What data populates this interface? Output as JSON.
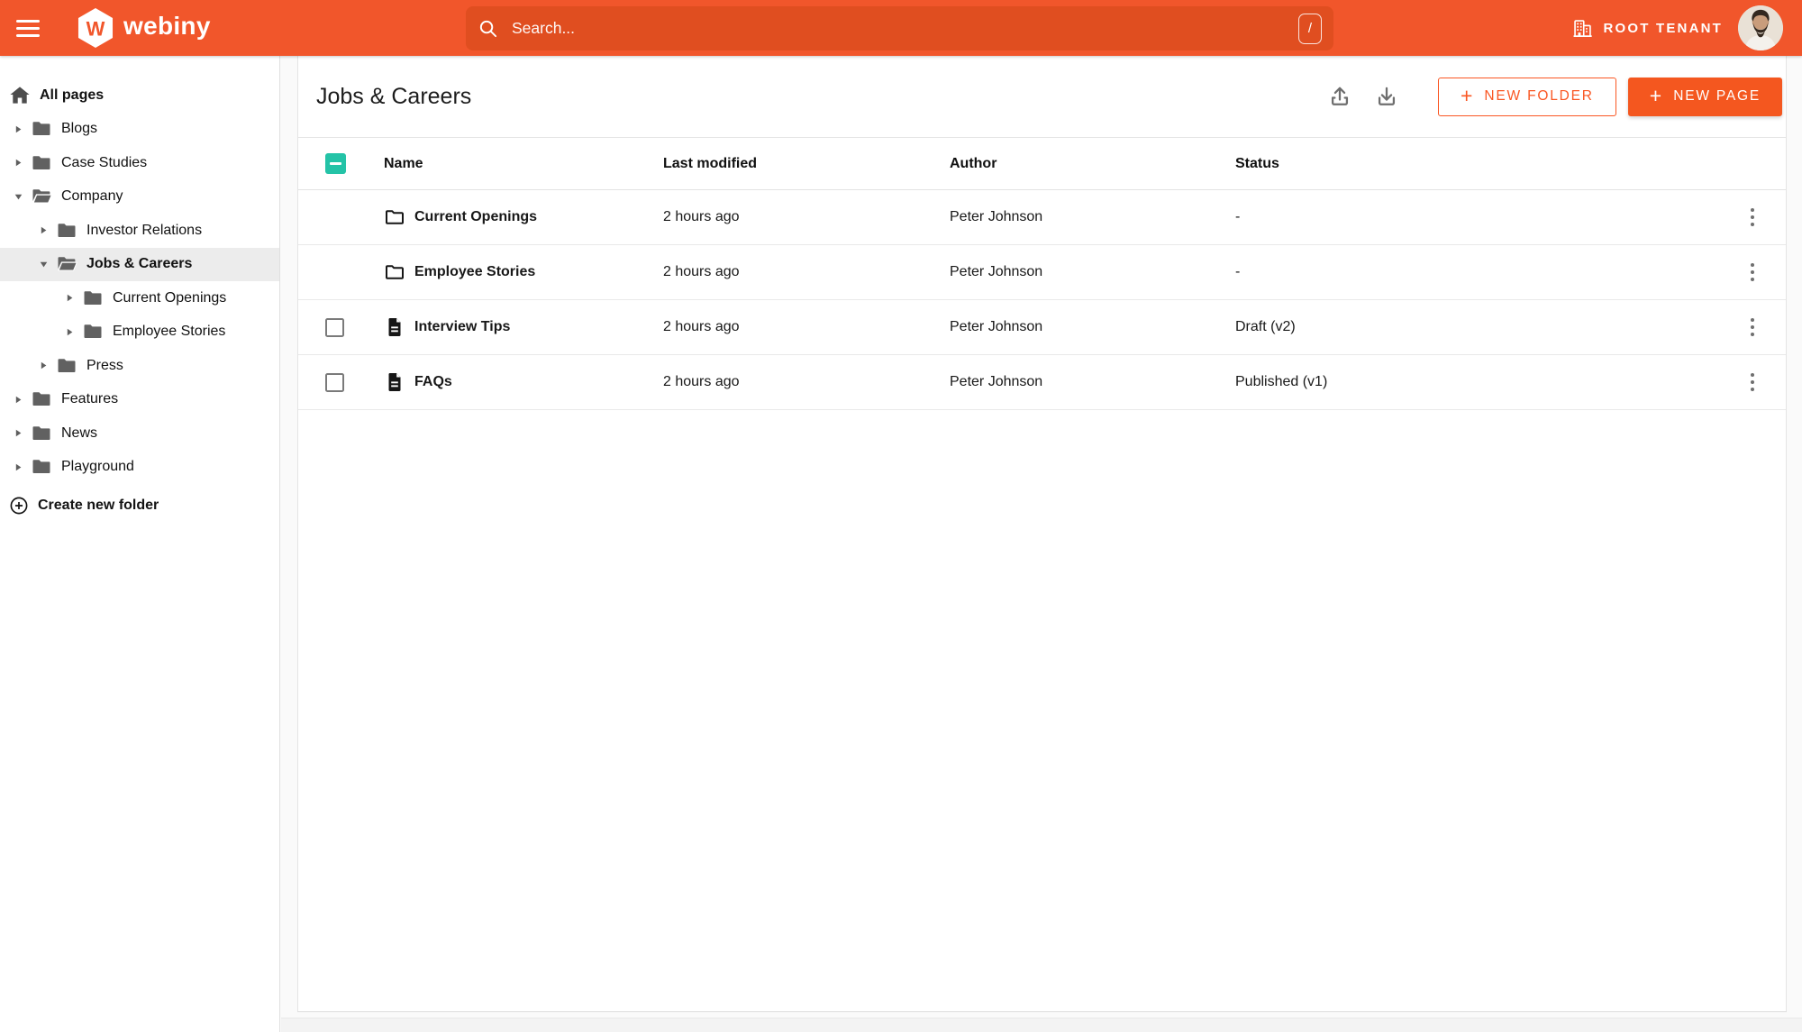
{
  "topbar": {
    "logo_initial": "W",
    "logo_text": "webiny",
    "search": {
      "placeholder": "Search...",
      "shortcut_key": "/"
    },
    "tenant": {
      "label": "ROOT TENANT"
    }
  },
  "sidebar": {
    "items": [
      {
        "label": "All pages",
        "icon": "home",
        "level": 0,
        "arrow": null,
        "bold": true,
        "selected": false
      },
      {
        "label": "Blogs",
        "icon": "folder",
        "level": 1,
        "arrow": "right",
        "bold": false,
        "selected": false
      },
      {
        "label": "Case Studies",
        "icon": "folder",
        "level": 1,
        "arrow": "right",
        "bold": false,
        "selected": false
      },
      {
        "label": "Company",
        "icon": "folder-open",
        "level": 1,
        "arrow": "down",
        "bold": false,
        "selected": false
      },
      {
        "label": "Investor Relations",
        "icon": "folder",
        "level": 2,
        "arrow": "right",
        "bold": false,
        "selected": false
      },
      {
        "label": "Jobs & Careers",
        "icon": "folder-open",
        "level": 2,
        "arrow": "down",
        "bold": true,
        "selected": true
      },
      {
        "label": "Current Openings",
        "icon": "folder",
        "level": 3,
        "arrow": "right",
        "bold": false,
        "selected": false
      },
      {
        "label": "Employee Stories",
        "icon": "folder",
        "level": 3,
        "arrow": "right",
        "bold": false,
        "selected": false
      },
      {
        "label": "Press",
        "icon": "folder",
        "level": 2,
        "arrow": "right",
        "bold": false,
        "selected": false
      },
      {
        "label": "Features",
        "icon": "folder",
        "level": 1,
        "arrow": "right",
        "bold": false,
        "selected": false
      },
      {
        "label": "News",
        "icon": "folder",
        "level": 1,
        "arrow": "right",
        "bold": false,
        "selected": false
      },
      {
        "label": "Playground",
        "icon": "folder",
        "level": 1,
        "arrow": "right",
        "bold": false,
        "selected": false
      }
    ],
    "create_folder_label": "Create new folder"
  },
  "main": {
    "title": "Jobs & Careers",
    "actions": {
      "new_folder_label": "NEW FOLDER",
      "new_page_label": "NEW PAGE",
      "plus_glyph": "+"
    },
    "table": {
      "columns": [
        "Name",
        "Last modified",
        "Author",
        "Status"
      ],
      "header_checkbox_state": "indeterminate",
      "rows": [
        {
          "type": "folder",
          "name": "Current Openings",
          "last_modified": "2 hours ago",
          "author": "Peter Johnson",
          "status": "-",
          "has_checkbox": false,
          "checked": false
        },
        {
          "type": "folder",
          "name": "Employee Stories",
          "last_modified": "2 hours ago",
          "author": "Peter Johnson",
          "status": "-",
          "has_checkbox": false,
          "checked": false
        },
        {
          "type": "page",
          "name": "Interview Tips",
          "last_modified": "2 hours ago",
          "author": "Peter Johnson",
          "status": "Draft (v2)",
          "has_checkbox": true,
          "checked": false
        },
        {
          "type": "page",
          "name": "FAQs",
          "last_modified": "2 hours ago",
          "author": "Peter Johnson",
          "status": "Published (v1)",
          "has_checkbox": true,
          "checked": false
        }
      ]
    }
  },
  "icons": {
    "topbar": [
      "menu-icon",
      "webiny-logo",
      "search-icon",
      "slash-shortcut-badge",
      "building-icon",
      "avatar"
    ],
    "header": [
      "upload-icon",
      "download-icon",
      "plus-icon"
    ],
    "tree": [
      "home-icon",
      "folder-icon",
      "folder-open-icon",
      "chevron-right-icon",
      "chevron-down-icon",
      "plus-circle-icon"
    ],
    "rows": [
      "folder-outline-icon",
      "document-icon",
      "kebab-menu-icon"
    ]
  },
  "colors": {
    "topbar_orange": "#F1562B",
    "search_bg": "#E04E20",
    "brand_orange": "#FA5723",
    "button_fill_orange": "#F4571F",
    "checkbox_teal": "#24C3A7",
    "sidebar_selected_bg": "#ECECEC",
    "icon_gray": "#616161",
    "border_gray": "#E5E5E5",
    "text_dark": "#141414"
  }
}
